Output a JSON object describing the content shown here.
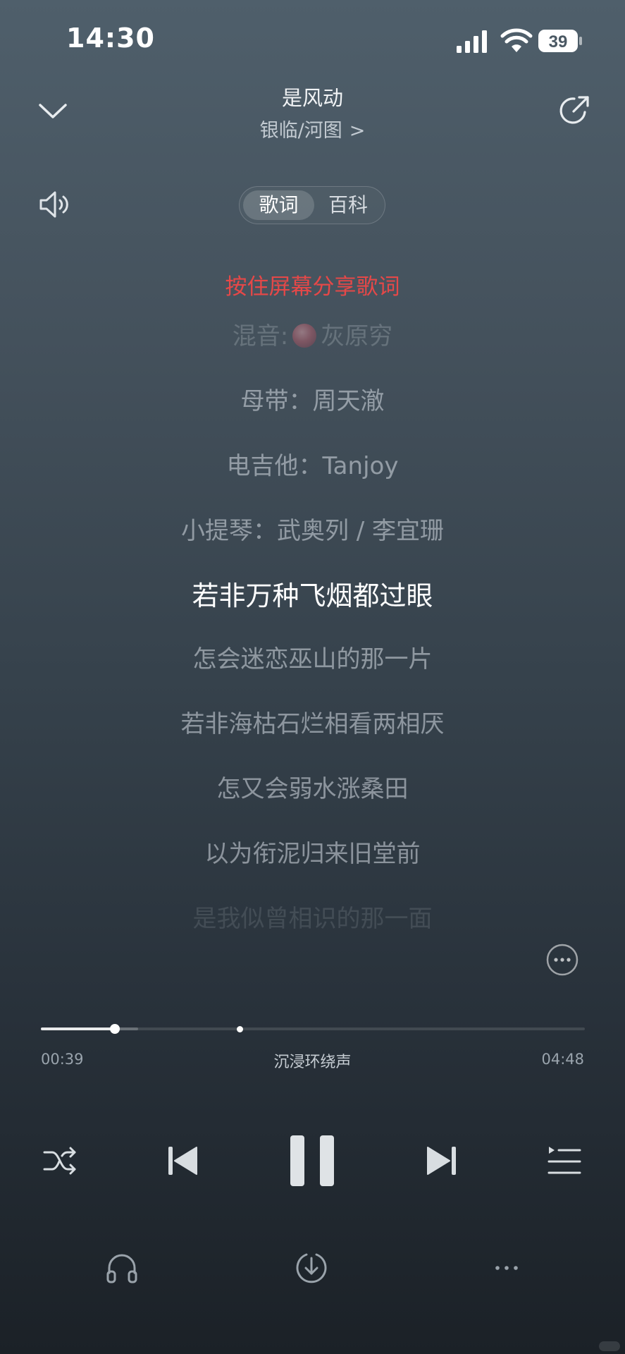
{
  "status_bar": {
    "time": "14:30",
    "battery": "39"
  },
  "header": {
    "title": "是风动",
    "artist": "银临/河图",
    "artist_chevron": ">"
  },
  "tabs": {
    "lyrics": "歌词",
    "wiki": "百科"
  },
  "lyrics": {
    "hint": "按住屏幕分享歌词",
    "mix_label": "混音:",
    "mix_name": "灰原穷",
    "lines": [
      "母带：周天澈",
      "电吉他：Tanjoy",
      "小提琴：武奥列 / 李宜珊",
      "若非万种飞烟都过眼",
      "怎会迷恋巫山的那一片",
      "若非海枯石烂相看两相厌",
      "怎又会弱水涨桑田",
      "以为衔泥归来旧堂前",
      "是我似曾相识的那一面"
    ],
    "active_index": 3
  },
  "progress": {
    "current": "00:39",
    "total": "04:48",
    "effect": "沉浸环绕声",
    "played_fraction": 0.135
  },
  "colors": {
    "hint": "#e54848",
    "accent": "#ffffff"
  },
  "icons": {
    "collapse": "chevron-down-icon",
    "share": "share-icon",
    "volume": "speaker-icon",
    "more": "more-circle-icon",
    "shuffle": "shuffle-icon",
    "prev": "previous-icon",
    "pause": "pause-icon",
    "next": "next-icon",
    "playlist": "playlist-icon",
    "headphone": "headphone-icon",
    "download": "download-icon",
    "menu": "more-dots-icon"
  }
}
